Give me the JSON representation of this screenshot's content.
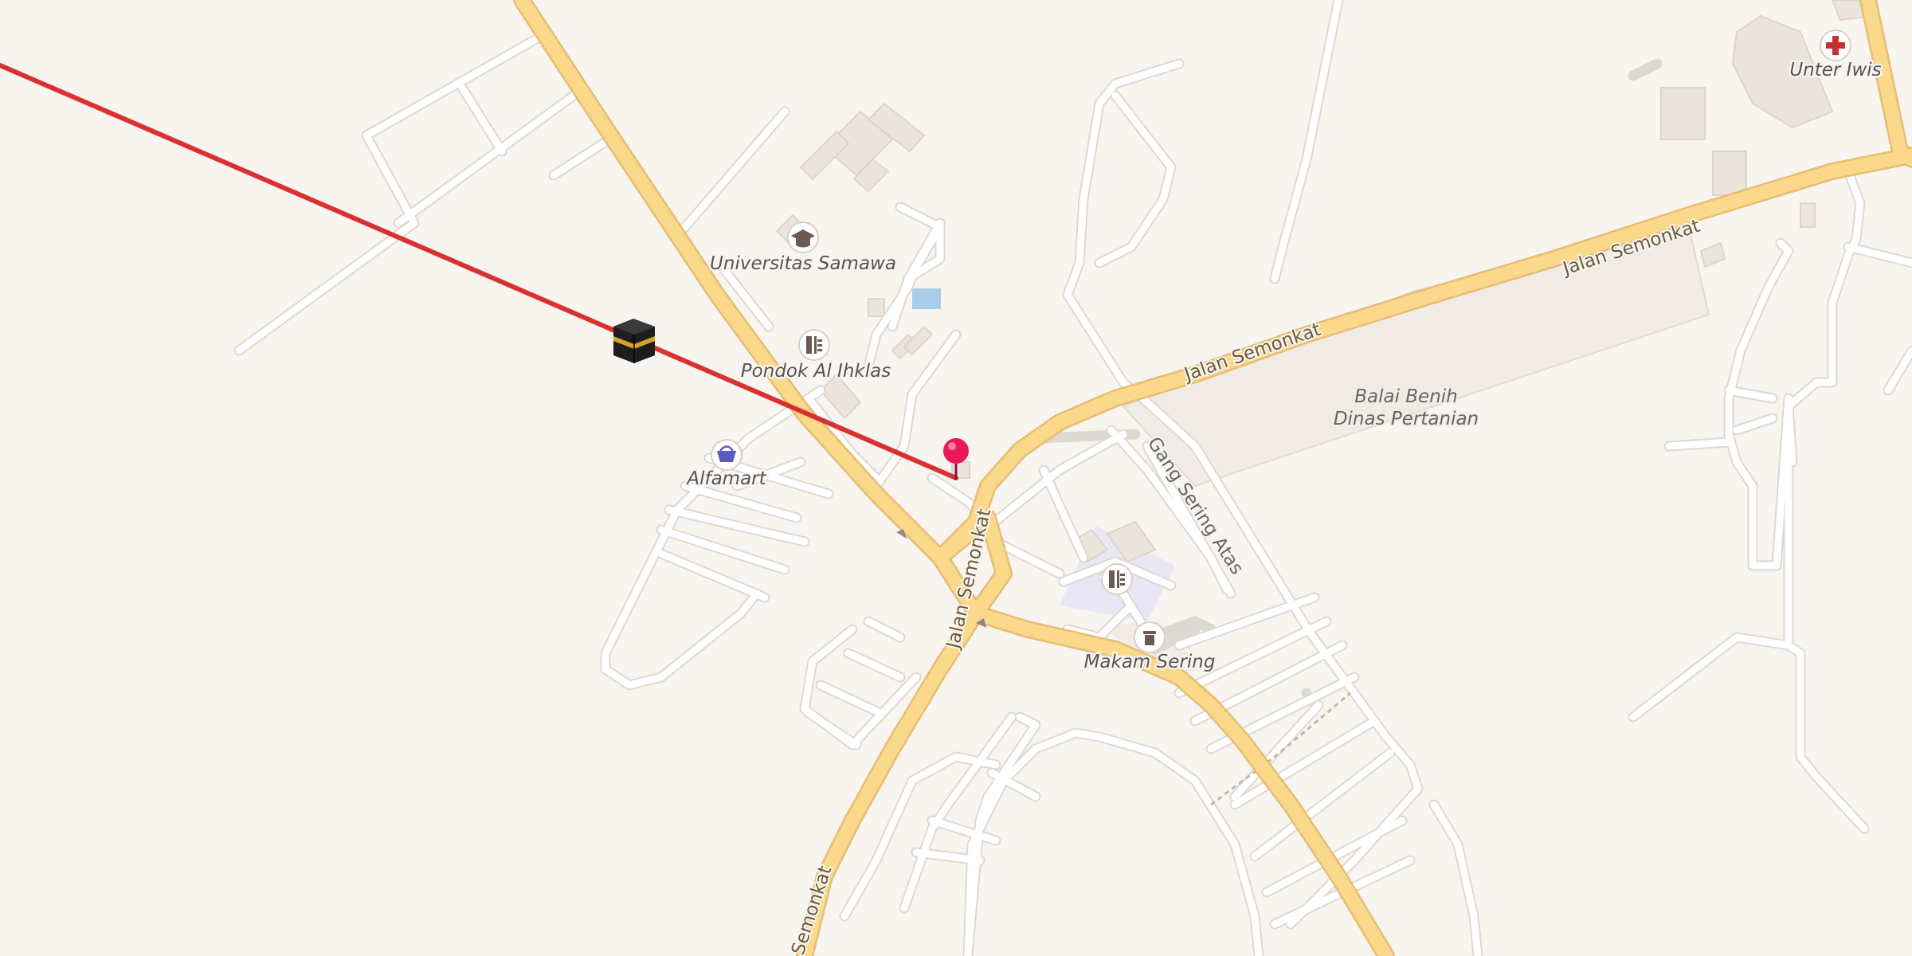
{
  "map": {
    "colors": {
      "background": "#f8f5f1",
      "major_road": "#fad98a",
      "major_road_casing": "#e8bc74",
      "minor_road": "#ffffff",
      "qibla_line": "#d93030",
      "pin": "#e8185a",
      "water": "#a9cde8",
      "landuse": "#f1ebe5",
      "religious_area": "#e9e6f6"
    },
    "streets": {
      "jalan_semonkat_1": "Jalan Semonkat",
      "jalan_semonkat_2": "Jalan Semonkat",
      "jalan_semonkat_3": "Jalan Semonkat",
      "jalan_semonkat_4": "Semonkat",
      "gang_sering_atas": "Gang Sering Atas"
    },
    "pois": {
      "universitas_samawa": {
        "label": "Universitas Samawa",
        "icon": "graduation-cap-icon"
      },
      "pondok_al_ihklas": {
        "label": "Pondok Al Ihklas",
        "icon": "school-building-icon"
      },
      "alfamart": {
        "label": "Alfamart",
        "icon": "shopping-basket-icon"
      },
      "makam_sering": {
        "label": "Makam Sering",
        "icon": "grave-icon"
      },
      "unter_iwis": {
        "label": "Unter Iwis",
        "icon": "medical-cross-icon"
      },
      "school_unlabeled": {
        "icon": "school-building-icon"
      }
    },
    "areas": {
      "balai_benih_line1": "Balai Benih",
      "balai_benih_line2": "Dinas Pertanian"
    },
    "markers": {
      "location_pin": {
        "icon": "location-pin-icon"
      },
      "kaaba": {
        "icon": "kaaba-icon"
      },
      "qibla_line": {
        "icon": "qibla-direction-line"
      }
    }
  }
}
